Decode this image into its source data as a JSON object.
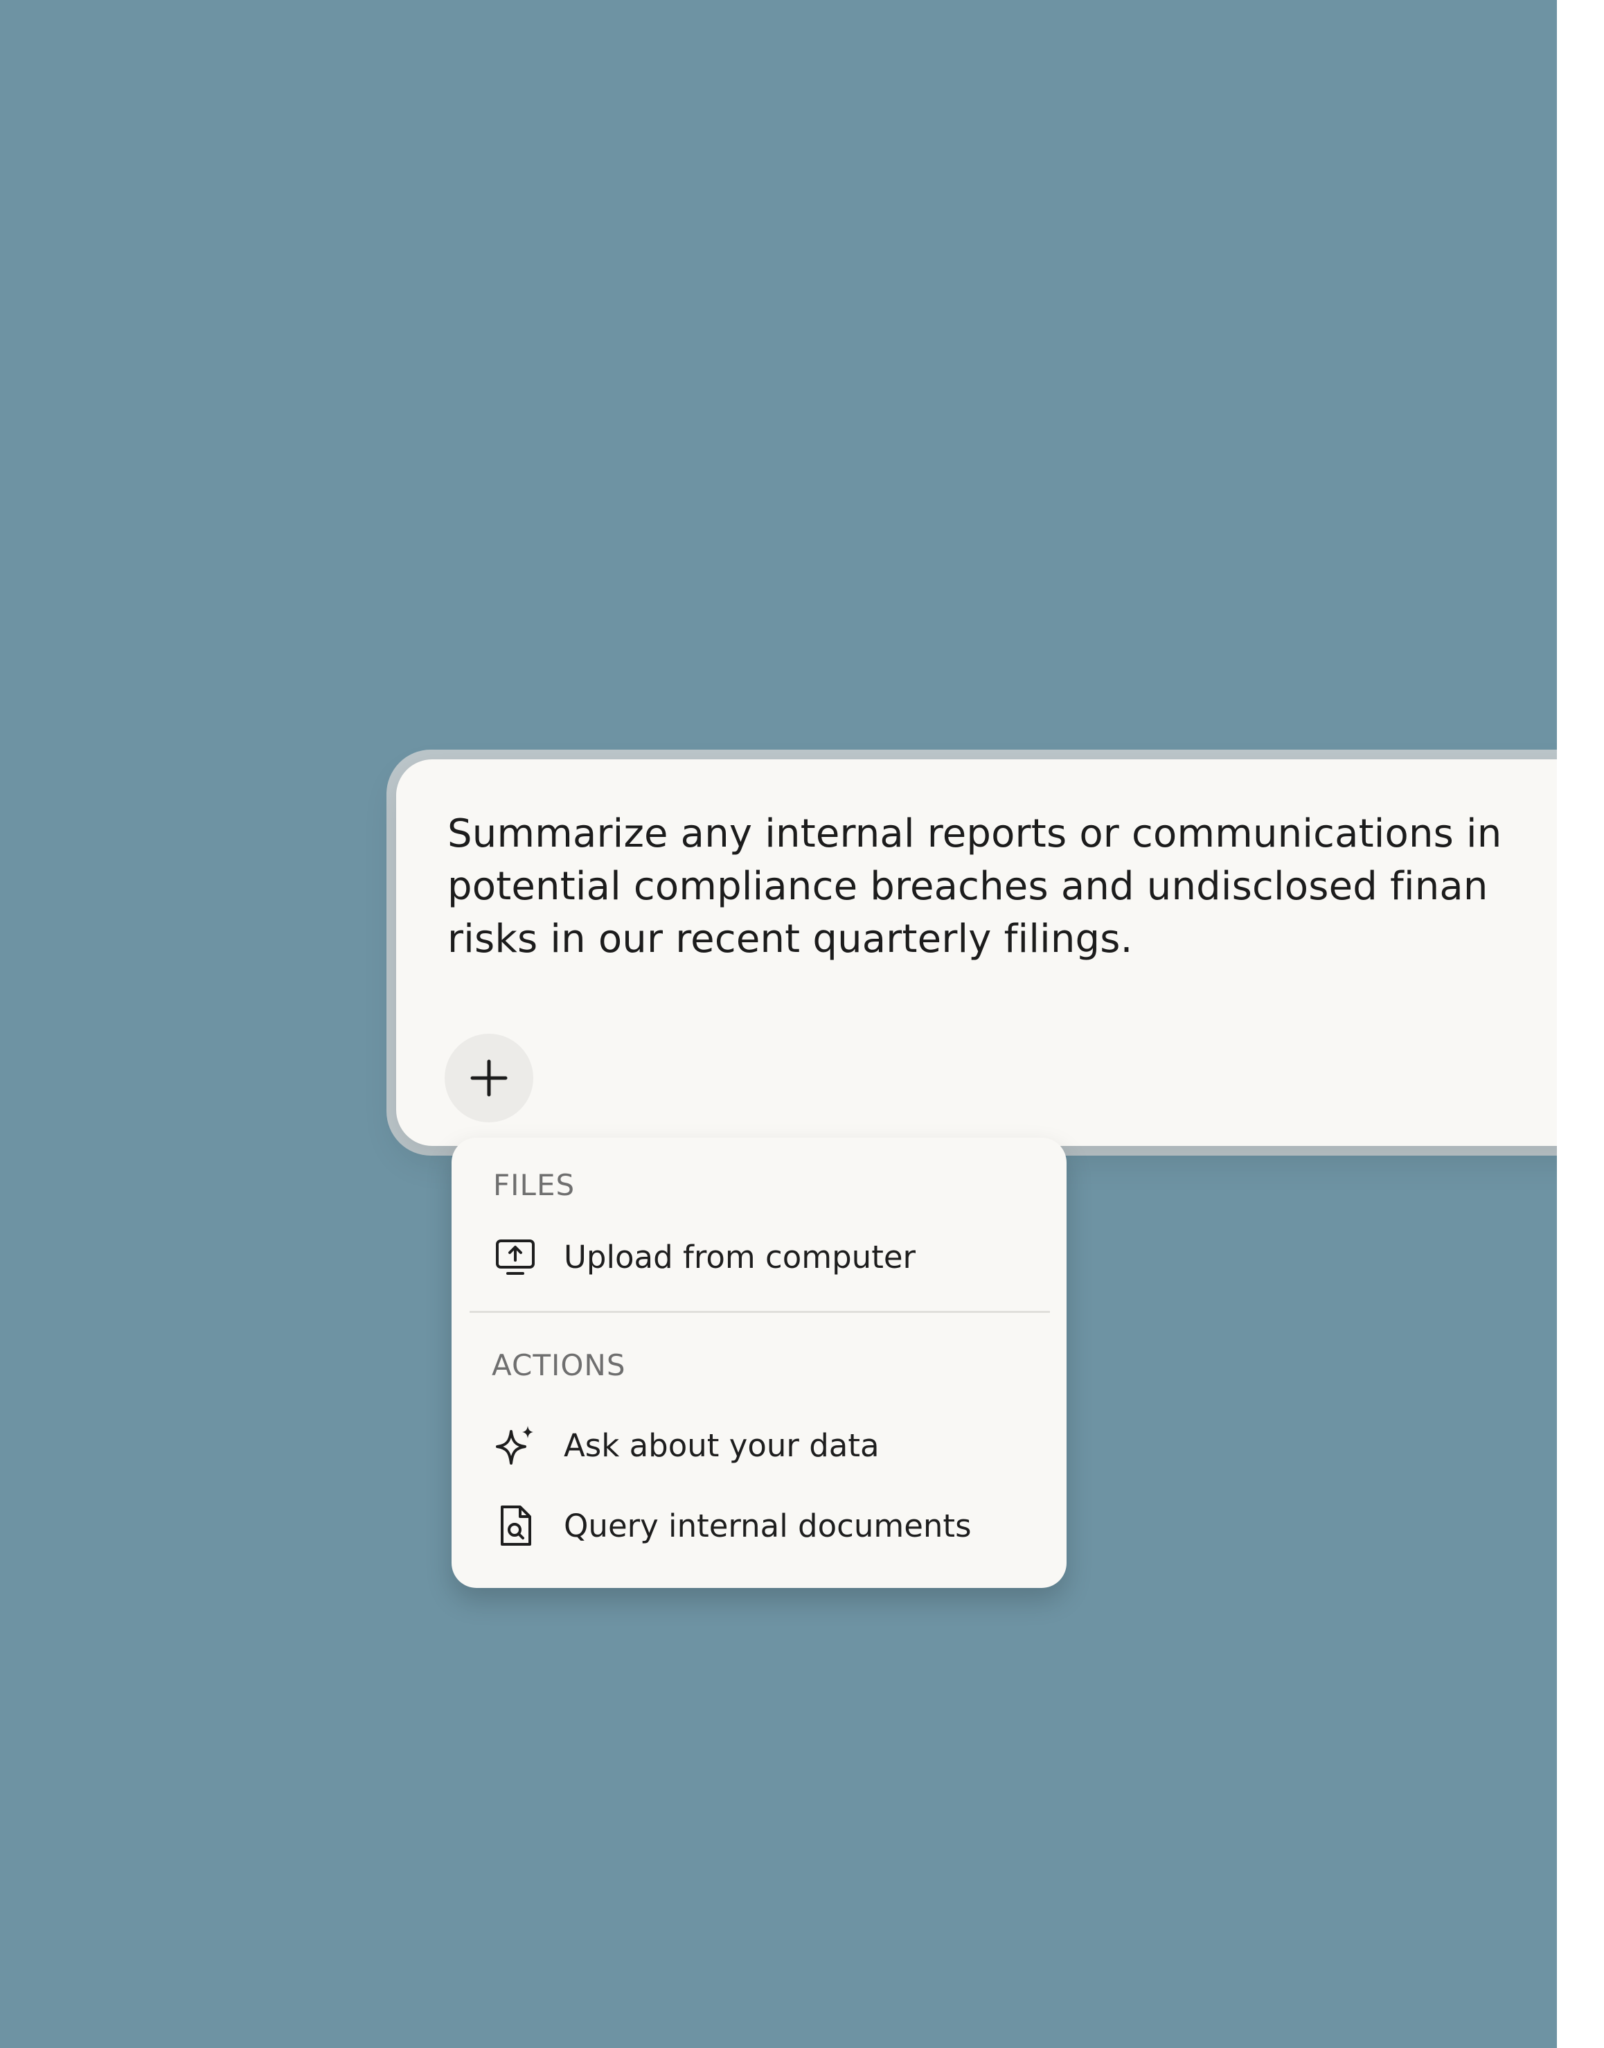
{
  "composer": {
    "prompt_text": "Summarize any internal reports or communications in\npotential compliance breaches and undisclosed finan\nrisks in our recent quarterly filings.",
    "attach_button_icon": "plus-icon"
  },
  "menu": {
    "files_label": "FILES",
    "upload_label": "Upload from computer",
    "upload_icon": "monitor-upload-icon",
    "actions_label": "ACTIONS",
    "ask_label": "Ask about your data",
    "ask_icon": "sparkle-icon",
    "query_label": "Query internal documents",
    "query_icon": "document-search-icon"
  },
  "colors": {
    "background": "#6e93a3",
    "surface": "#f9f8f5",
    "text": "#1c1c1c",
    "section_label": "#6f6f6f"
  }
}
